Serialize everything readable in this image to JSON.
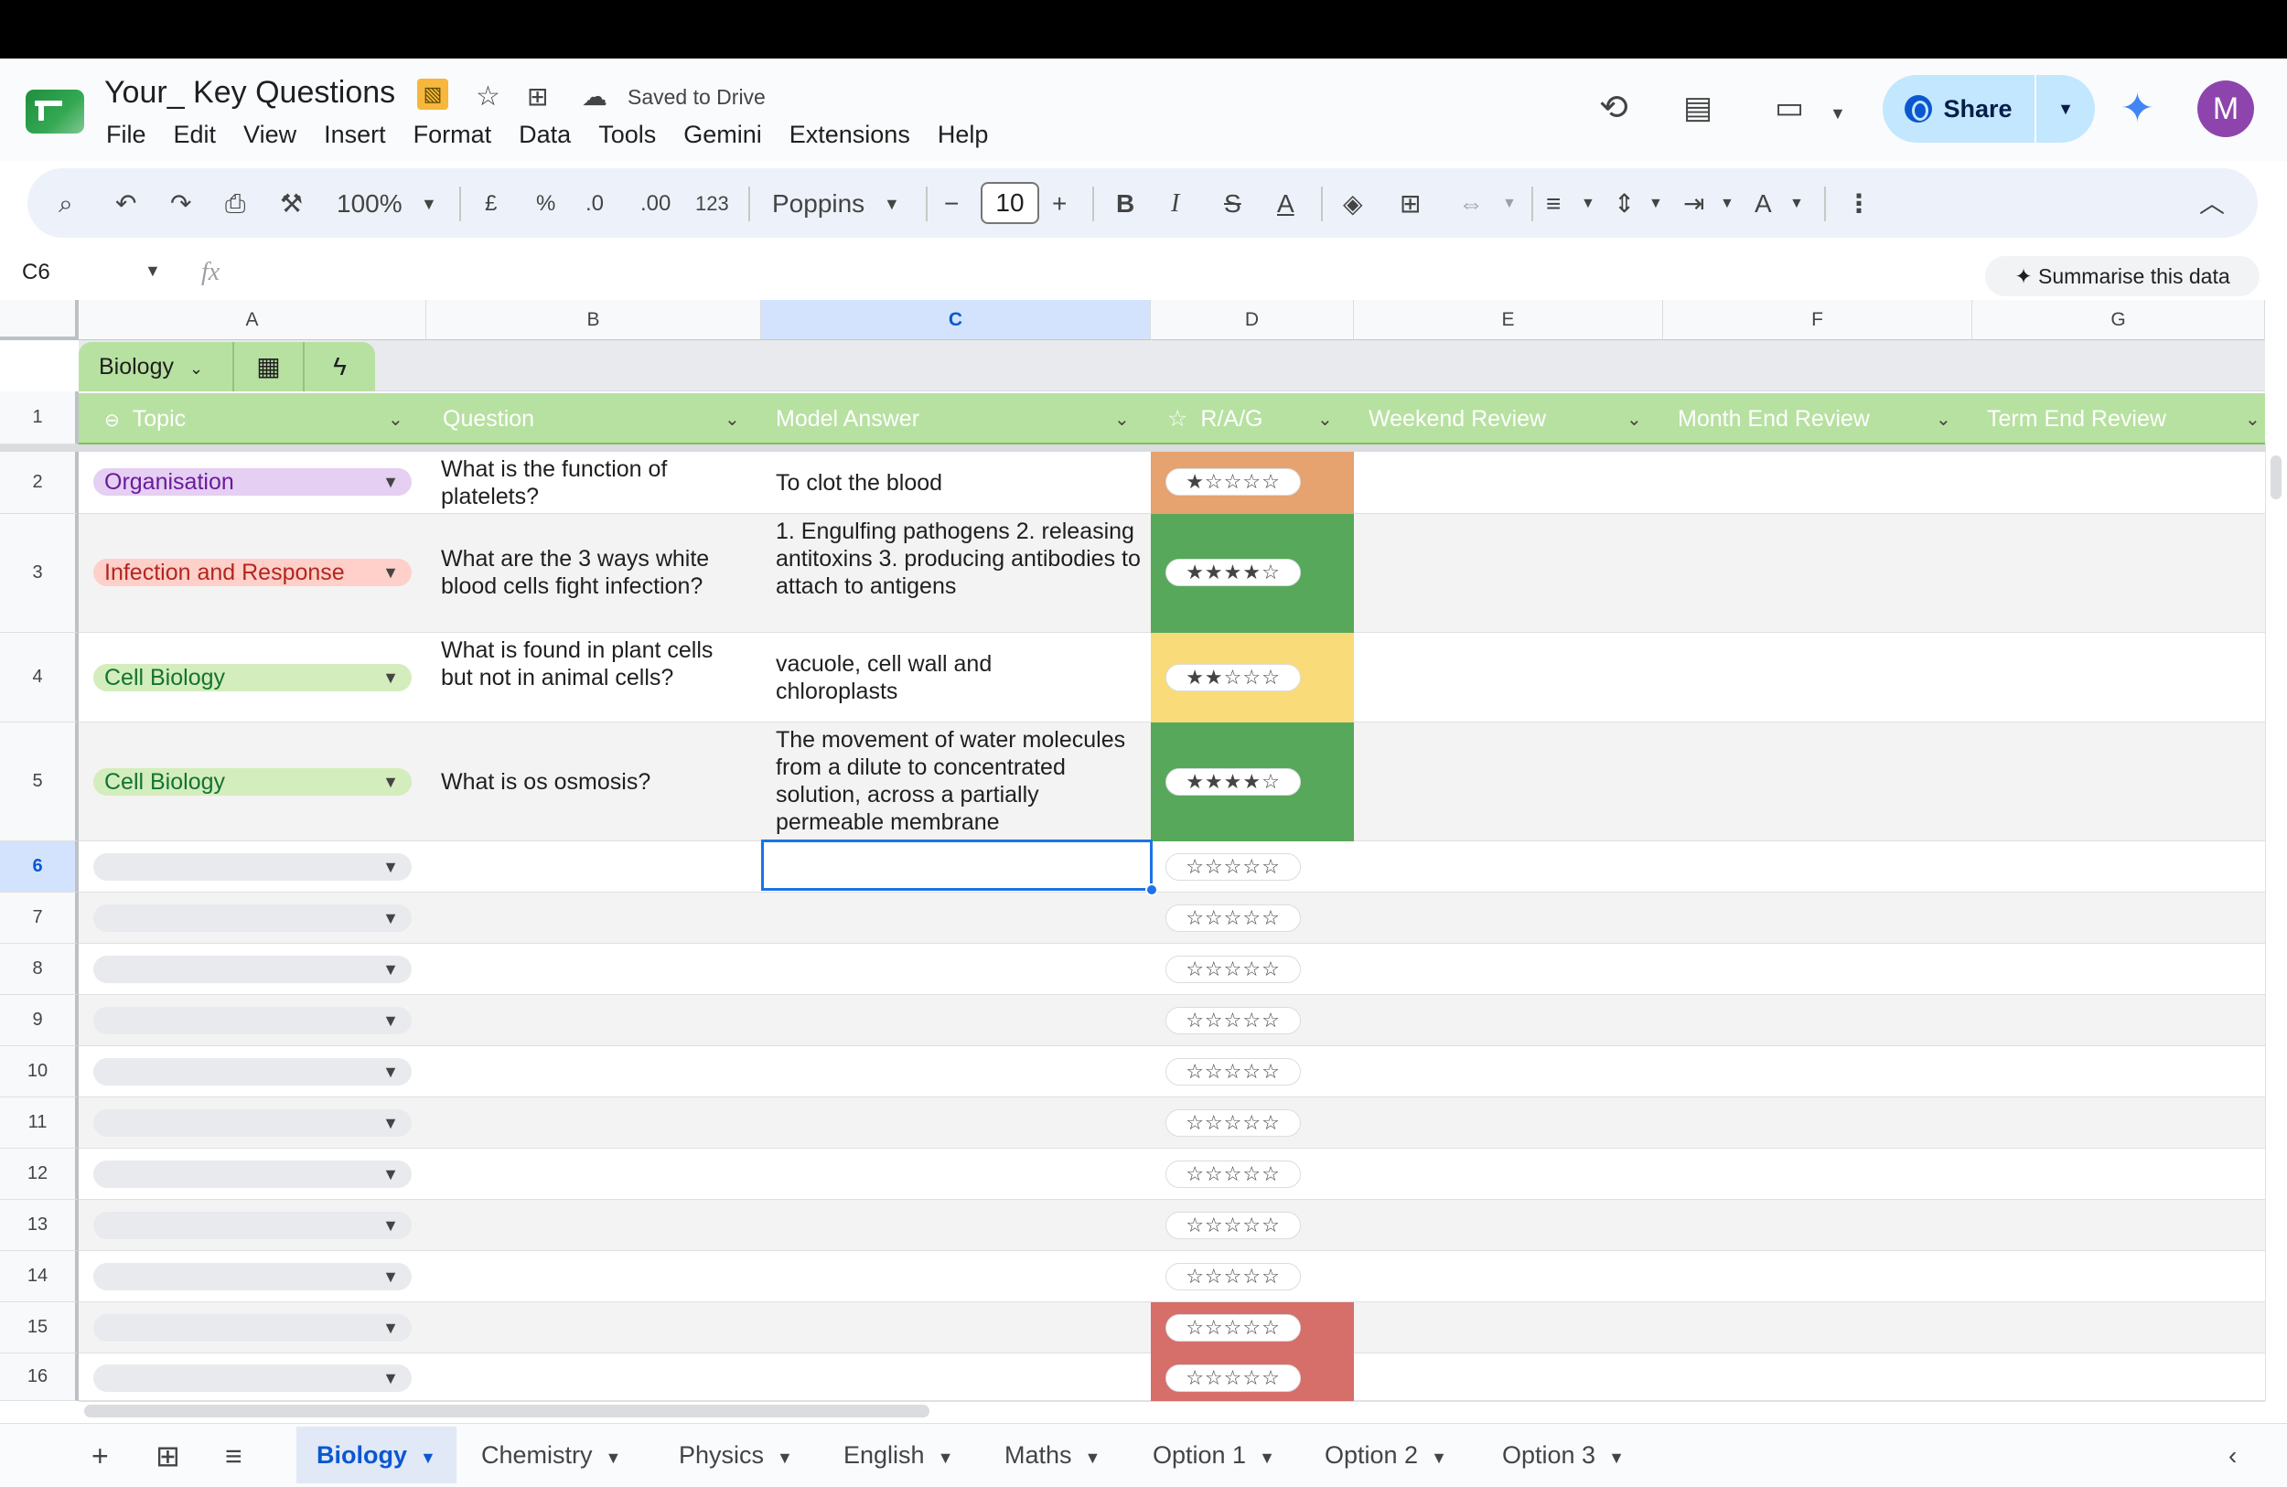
{
  "doc": {
    "title": "Your_ Key Questions",
    "saved": "Saved to Drive"
  },
  "menu": [
    "File",
    "Edit",
    "View",
    "Insert",
    "Format",
    "Data",
    "Tools",
    "Gemini",
    "Extensions",
    "Help"
  ],
  "share": {
    "label": "Share"
  },
  "avatar": {
    "initial": "M",
    "color": "#8e44ad"
  },
  "toolbar": {
    "zoom": "100%",
    "currency": "£",
    "percent": "%",
    "dec_dec": ".0",
    "dec_inc": ".00",
    "format": "123",
    "font": "Poppins",
    "font_size": "10",
    "bold": "B",
    "italic": "I",
    "strike": "S",
    "text_color": "A",
    "text_rot": "A"
  },
  "formula": {
    "cell_ref": "C6",
    "fx": "fx",
    "summarise": "✦ Summarise this data"
  },
  "columns": [
    "A",
    "B",
    "C",
    "D",
    "E",
    "F",
    "G"
  ],
  "table": {
    "name": "Biology"
  },
  "header": {
    "topic": "Topic",
    "question": "Question",
    "model_answer": "Model Answer",
    "rag": "R/A/G",
    "weekend": "Weekend Review",
    "month": "Month End Review",
    "term": "Term End Review"
  },
  "row_numbers": [
    "1",
    "2",
    "3",
    "4",
    "5",
    "6",
    "7",
    "8",
    "9",
    "10",
    "11",
    "12",
    "13",
    "14",
    "15",
    "16"
  ],
  "rows": [
    {
      "topic": "Organisation",
      "question": "What is the function of platelets?",
      "answer": "To clot the blood",
      "rating": 1,
      "stars": "★☆☆☆☆"
    },
    {
      "topic": "Infection and Response",
      "question": "What are the 3 ways white blood cells fight infection?",
      "answer": "1. Engulfing pathogens 2. releasing antitoxins 3. producing antibodies to attach to antigens",
      "rating": 4,
      "stars": "★★★★☆"
    },
    {
      "topic": "Cell Biology",
      "question": "What is found in plant cells but not in animal cells?",
      "answer": "vacuole, cell wall and chloroplasts",
      "rating": 2,
      "stars": "★★☆☆☆"
    },
    {
      "topic": "Cell Biology",
      "question": "What is os osmosis?",
      "answer": "The movement of water molecules from a dilute to concentrated solution, across a partially permeable membrane",
      "rating": 4,
      "stars": "★★★★☆"
    }
  ],
  "empty_stars": "☆☆☆☆☆",
  "colors": {
    "organisation": "#e5cff2",
    "infection": "#ffcfc9",
    "cell_biology": "#d4edbc",
    "empty_chip": "#e8eaed",
    "rag_1": "#e6a26f",
    "rag_4": "#57a85a",
    "rag_2": "#fadb7a",
    "rag_0": "#d66e6a",
    "header_green": "#b7e1a1",
    "selection": "#1a73e8"
  },
  "sheets": [
    "Biology",
    "Chemistry",
    "Physics",
    "English",
    "Maths",
    "Option 1",
    "Option 2",
    "Option 3"
  ]
}
